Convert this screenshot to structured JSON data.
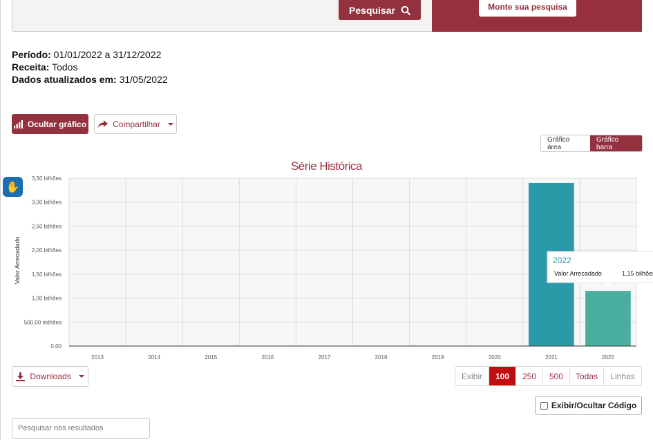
{
  "search": {
    "button_label": "Pesquisar",
    "build_label": "Monte sua pesquisa"
  },
  "info": {
    "periodo_label": "Período:",
    "periodo_value": "01/01/2022 a 31/12/2022",
    "receita_label": "Receita:",
    "receita_value": "Todos",
    "dados_label": "Dados atualizados em:",
    "dados_value": "31/05/2022"
  },
  "toolbar": {
    "hide_chart_label": "Ocultar gráfico",
    "share_label": "Compartilhar",
    "chart_area_label": "Gráfico área",
    "chart_bar_label": "Gráfico barra"
  },
  "chart_data": {
    "type": "bar",
    "title": "Série Histórica",
    "xlabel": "",
    "ylabel": "Valor Arrecadado",
    "categories": [
      "2013",
      "2014",
      "2015",
      "2016",
      "2017",
      "2018",
      "2019",
      "2020",
      "2021",
      "2022"
    ],
    "series": [
      {
        "name": "Valor Arrecadado",
        "values": [
          0,
          0,
          0,
          0,
          0,
          0,
          0,
          0,
          3400000000,
          1150000000
        ]
      }
    ],
    "ylim": [
      0,
      3500000000
    ],
    "yticks": [
      0,
      500000000,
      1000000000,
      1500000000,
      2000000000,
      2500000000,
      3000000000,
      3500000000
    ],
    "ytick_labels": [
      "0,00",
      "500,00 milhões",
      "1,00 bilhões",
      "1,50 bilhões",
      "2,00 bilhões",
      "2,50 bilhões",
      "3,00 bilhões",
      "3,50 bilhões"
    ],
    "colors": [
      "#2b9aa8",
      "#4aae9f"
    ],
    "grid": true,
    "tooltip": {
      "title": "2022",
      "label": "Valor Arrecadado",
      "value": "1,15 bilhões"
    }
  },
  "bottom": {
    "downloads_label": "Downloads",
    "pager": [
      "Exibir",
      "100",
      "250",
      "500",
      "Todas",
      "Linhas"
    ],
    "code_toggle_label": "Exibir/Ocultar Código",
    "results_placeholder": "Pesquisar nos resultados"
  },
  "colors": {
    "brand": "#94313e",
    "active_page": "#c00d10"
  }
}
